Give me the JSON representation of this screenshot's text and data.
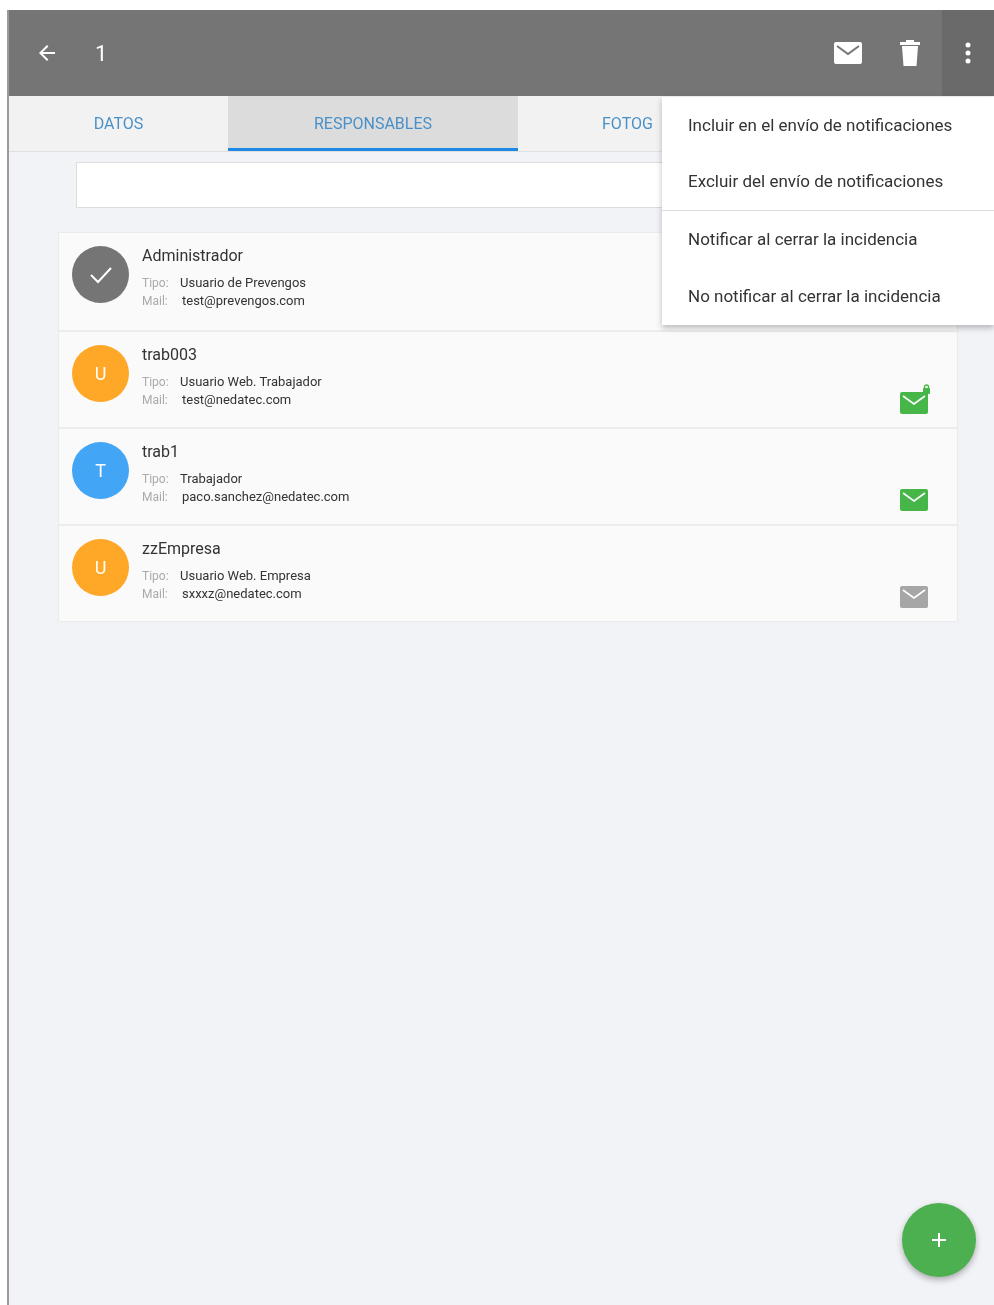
{
  "toolbar": {
    "title": "1"
  },
  "tabs": [
    {
      "label": "DATOS",
      "selected": false
    },
    {
      "label": "RESPONSABLES",
      "selected": true
    },
    {
      "label": "FOTOG",
      "selected": false
    }
  ],
  "people": [
    {
      "name": "Administrador",
      "avatar": {
        "kind": "check",
        "color": "#757575"
      },
      "tipo_label": "Tipo:",
      "tipo": "Usuario de Prevengos",
      "mail_label": "Mail:",
      "mail": "test@prevengos.com"
    },
    {
      "name": "trab003",
      "avatar": {
        "kind": "letter",
        "letter": "U",
        "color": "#ffa726"
      },
      "tipo_label": "Tipo:",
      "tipo": "Usuario Web. Trabajador",
      "mail_label": "Mail:",
      "mail": "test@nedatec.com",
      "notify": true,
      "locked": true
    },
    {
      "name": "trab1",
      "avatar": {
        "kind": "letter",
        "letter": "T",
        "color": "#42a5f5"
      },
      "tipo_label": "Tipo:",
      "tipo": "Trabajador",
      "mail_label": "Mail:",
      "mail": "paco.sanchez@nedatec.com",
      "notify": true,
      "locked": false
    },
    {
      "name": "zzEmpresa",
      "avatar": {
        "kind": "letter",
        "letter": "U",
        "color": "#ffa726"
      },
      "tipo_label": "Tipo:",
      "tipo": "Usuario Web. Empresa",
      "mail_label": "Mail:",
      "mail": "sxxxz@nedatec.com",
      "notify": false,
      "locked": false
    }
  ],
  "menu": [
    {
      "label": "Incluir en el envío de notificaciones",
      "divider_after": false
    },
    {
      "label": "Excluir del envío de notificaciones",
      "divider_after": true
    },
    {
      "label": "Notificar al cerrar la incidencia",
      "divider_after": false
    },
    {
      "label": "No notificar al cerrar la incidencia",
      "divider_after": false
    }
  ]
}
